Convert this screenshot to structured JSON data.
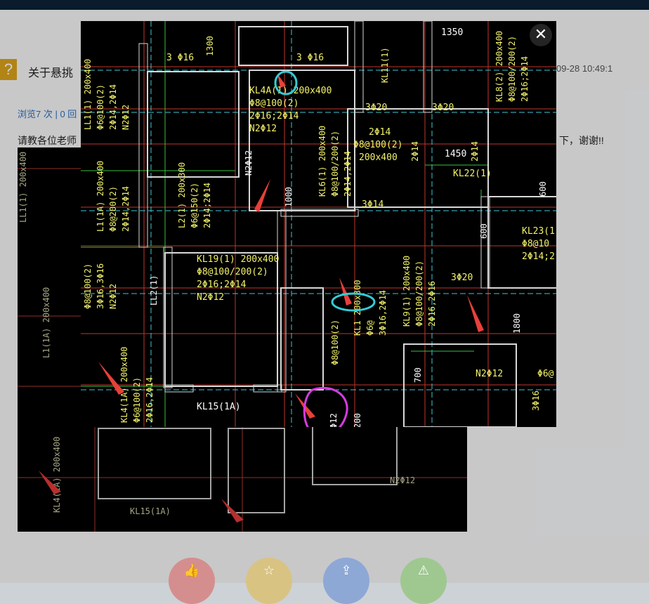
{
  "post": {
    "title": "关于悬挑",
    "date": "09-28 10:49:1",
    "stats": "浏览7 次 | 0 回",
    "body_start": "请教各位老师",
    "body_end": "N 下，谢谢!!"
  },
  "actions": [
    {
      "name": "like",
      "icon": "thumbs-up-icon",
      "glyph": "👍",
      "color": "#e6a7a7"
    },
    {
      "name": "favorite",
      "icon": "star-icon",
      "glyph": "☆",
      "color": "#e9d6a0"
    },
    {
      "name": "share",
      "icon": "share-icon",
      "glyph": "⇪",
      "color": "#a7bfe6"
    },
    {
      "name": "report",
      "icon": "warning-icon",
      "glyph": "⚠",
      "color": "#b5d9a8"
    }
  ],
  "lightbox": {
    "close_icon": "close-icon",
    "close_glyph": "✕",
    "cad_labels": {
      "l1": "3 Φ16",
      "l2": "1300",
      "l3": "3 Φ16",
      "l4": "KL11(1)",
      "l5": "1350",
      "l6": "KL8(2) 200x400",
      "l7": "Φ8@100/200(2)",
      "l8": "2Φ16;2Φ14",
      "l9": "KL4A(1) 200x400",
      "l10": "Φ8@100(2)",
      "l11": "2Φ16;2Φ14",
      "l12": "N2Φ12",
      "l13": "3Φ20",
      "l14": "3Φ20",
      "l15": "2Φ14",
      "l16": "Φ8@100(2)",
      "l17": "200x400",
      "l18": "1450",
      "l19": "KL22(1)",
      "l20": "LL1(1) 200x400",
      "l21": "Φ6@100(2)",
      "l22": "2Φ14,2Φ14",
      "l23": "N2Φ12",
      "l24": "L1(1A) 200x400",
      "l25": "Φ8@200(2)",
      "l26": "2Φ14,2Φ14",
      "l27": "L2(1) 200x300",
      "l28": "Φ6@150(2)",
      "l29": "2Φ14;2Φ14",
      "l30": "1000",
      "l31": "N2Φ12",
      "l32": "KL6(1) 200x400",
      "l33": "Φ8@100/200(2)",
      "l34": "2Φ14,2Φ14",
      "l35": "3Φ14",
      "l36": "KL23(1",
      "l37": "Φ8@10",
      "l38": "2Φ14;2",
      "l39": "KL19(1) 200x400",
      "l40": "Φ8@100/200(2)",
      "l41": "2Φ16;2Φ14",
      "l42": "N2Φ12",
      "l43": "LL2(1)",
      "l44": "Φ8@100(2)",
      "l45": "3Φ16,3Φ16",
      "l46": "N2Φ12",
      "l47": "KL1 200x300",
      "l48": "Φ6@",
      "l49": "3Φ16,2Φ14",
      "l50": "KL9(1) 200x400",
      "l51": "Φ8@100/200(2)",
      "l52": "2Φ16,2Φ16",
      "l53": "3Φ20",
      "l54": "1800",
      "l55": "Φ8@100(2)",
      "l56": "KL4(1A) 200x400",
      "l57": "Φ6@100(2)",
      "l58": "2Φ16,2Φ14",
      "l59": "KL15(1A)",
      "l60": "N2Φ12",
      "l61": "700",
      "l62": "Φ6@",
      "l63": "3Φ16",
      "l64": "Φ12",
      "l65": "600",
      "l66": "600",
      "l67": "2Φ14",
      "l68": "200",
      "l69": "KL15(1A)",
      "l70": "N2Φ12"
    }
  }
}
